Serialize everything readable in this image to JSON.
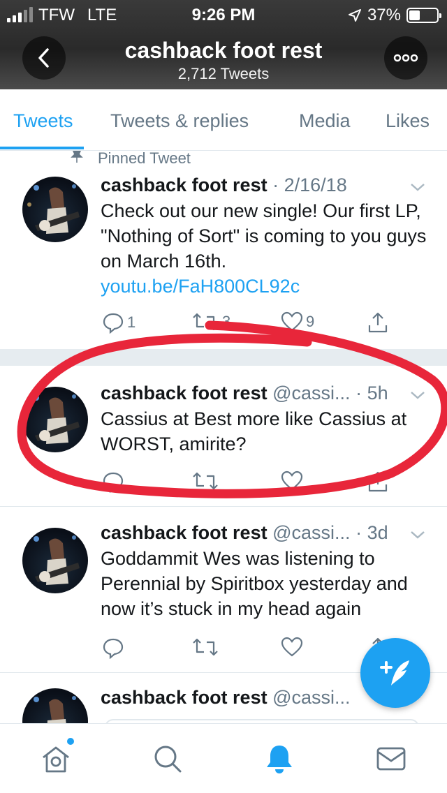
{
  "status_bar": {
    "carrier": "TFW",
    "network": "LTE",
    "time": "9:26 PM",
    "battery": "37%"
  },
  "header": {
    "title": "cashback foot rest",
    "subtitle": "2,712 Tweets",
    "back_icon": "chevron-left-icon",
    "more_icon": "more-dots-icon"
  },
  "tabs": [
    {
      "label": "Tweets",
      "active": true
    },
    {
      "label": "Tweets & replies"
    },
    {
      "label": "Media"
    },
    {
      "label": "Likes"
    }
  ],
  "pinned_label": "Pinned Tweet",
  "tweets": [
    {
      "name": "cashback foot rest",
      "handle": "",
      "sep": "·",
      "time": "2/16/18",
      "text": "Check out our new single! Our first LP, \"Nothing of Sort\" is coming to you guys on March 16th.",
      "link": "youtu.be/FaH800CL92c",
      "replies": "1",
      "retweets": "3",
      "likes": "9"
    },
    {
      "name": "cashback foot rest",
      "handle": "@cassi...",
      "sep": "·",
      "time": "5h",
      "text": "Cassius at Best more like Cassius at WORST, amirite?",
      "replies": "",
      "retweets": "",
      "likes": ""
    },
    {
      "name": "cashback foot rest",
      "handle": "@cassi...",
      "sep": "·",
      "time": "3d",
      "text": "Goddammit Wes was listening to Perennial by Spiritbox yesterday and now it’s stuck in my head again",
      "replies": "",
      "retweets": "",
      "likes": ""
    },
    {
      "name": "cashback foot rest",
      "handle": "@cassi...",
      "sep": "",
      "time": ""
    }
  ],
  "colors": {
    "accent": "#1da1f2",
    "annotation": "#e8263a"
  },
  "bottom_nav": [
    "home-icon",
    "search-icon",
    "notifications-icon",
    "messages-icon"
  ]
}
